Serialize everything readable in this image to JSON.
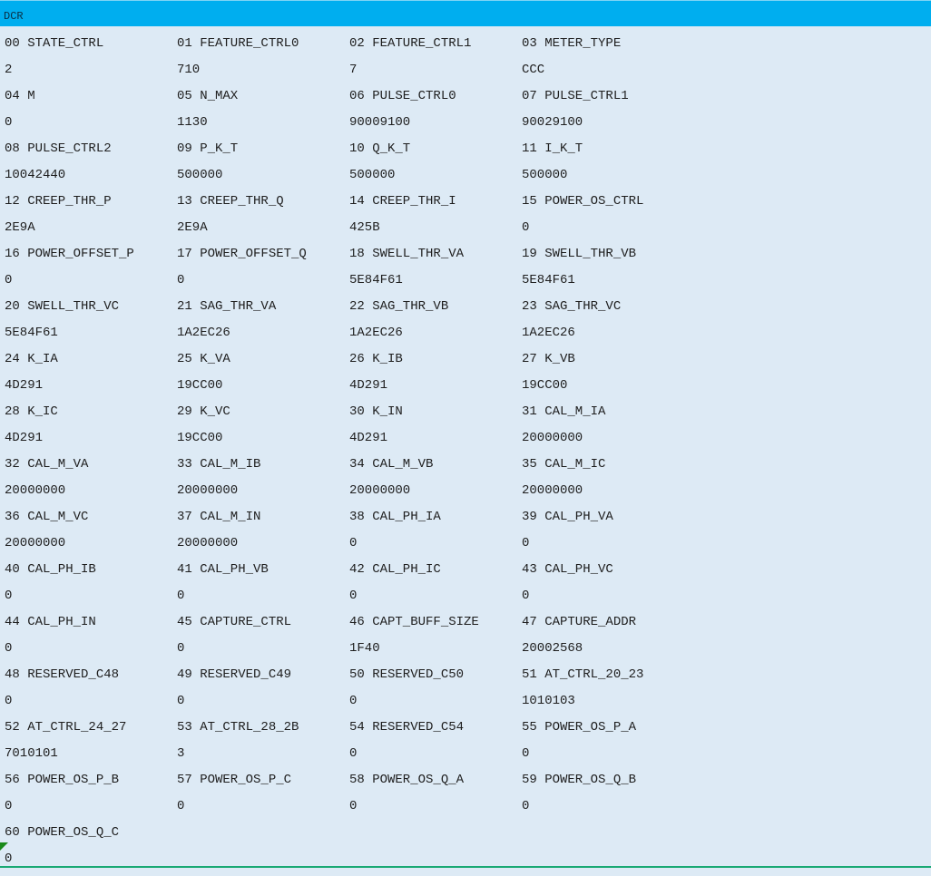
{
  "window": {
    "title": "DCR"
  },
  "registers": [
    {
      "name": "00 STATE_CTRL",
      "value": "2"
    },
    {
      "name": "01 FEATURE_CTRL0",
      "value": "710"
    },
    {
      "name": "02 FEATURE_CTRL1",
      "value": "7"
    },
    {
      "name": "03 METER_TYPE",
      "value": "CCC"
    },
    {
      "name": "04 M",
      "value": "0"
    },
    {
      "name": "05 N_MAX",
      "value": "1130"
    },
    {
      "name": "06 PULSE_CTRL0",
      "value": "90009100"
    },
    {
      "name": "07 PULSE_CTRL1",
      "value": "90029100"
    },
    {
      "name": "08 PULSE_CTRL2",
      "value": "10042440"
    },
    {
      "name": "09 P_K_T",
      "value": "500000"
    },
    {
      "name": "10 Q_K_T",
      "value": "500000"
    },
    {
      "name": "11 I_K_T",
      "value": "500000"
    },
    {
      "name": "12 CREEP_THR_P",
      "value": "2E9A"
    },
    {
      "name": "13 CREEP_THR_Q",
      "value": "2E9A"
    },
    {
      "name": "14 CREEP_THR_I",
      "value": "425B"
    },
    {
      "name": "15 POWER_OS_CTRL",
      "value": "0"
    },
    {
      "name": "16 POWER_OFFSET_P",
      "value": "0"
    },
    {
      "name": "17 POWER_OFFSET_Q",
      "value": "0"
    },
    {
      "name": "18 SWELL_THR_VA",
      "value": "5E84F61"
    },
    {
      "name": "19 SWELL_THR_VB",
      "value": "5E84F61"
    },
    {
      "name": "20 SWELL_THR_VC",
      "value": "5E84F61"
    },
    {
      "name": "21 SAG_THR_VA",
      "value": "1A2EC26"
    },
    {
      "name": "22 SAG_THR_VB",
      "value": "1A2EC26"
    },
    {
      "name": "23 SAG_THR_VC",
      "value": "1A2EC26"
    },
    {
      "name": "24 K_IA",
      "value": "4D291"
    },
    {
      "name": "25 K_VA",
      "value": "19CC00"
    },
    {
      "name": "26 K_IB",
      "value": "4D291"
    },
    {
      "name": "27 K_VB",
      "value": "19CC00"
    },
    {
      "name": "28 K_IC",
      "value": "4D291"
    },
    {
      "name": "29 K_VC",
      "value": "19CC00"
    },
    {
      "name": "30 K_IN",
      "value": "4D291"
    },
    {
      "name": "31 CAL_M_IA",
      "value": "20000000"
    },
    {
      "name": "32 CAL_M_VA",
      "value": "20000000"
    },
    {
      "name": "33 CAL_M_IB",
      "value": "20000000"
    },
    {
      "name": "34 CAL_M_VB",
      "value": "20000000"
    },
    {
      "name": "35 CAL_M_IC",
      "value": "20000000"
    },
    {
      "name": "36 CAL_M_VC",
      "value": "20000000"
    },
    {
      "name": "37 CAL_M_IN",
      "value": "20000000"
    },
    {
      "name": "38 CAL_PH_IA",
      "value": "0"
    },
    {
      "name": "39 CAL_PH_VA",
      "value": "0"
    },
    {
      "name": "40 CAL_PH_IB",
      "value": "0"
    },
    {
      "name": "41 CAL_PH_VB",
      "value": "0"
    },
    {
      "name": "42 CAL_PH_IC",
      "value": "0"
    },
    {
      "name": "43 CAL_PH_VC",
      "value": "0"
    },
    {
      "name": "44 CAL_PH_IN",
      "value": "0"
    },
    {
      "name": "45 CAPTURE_CTRL",
      "value": "0"
    },
    {
      "name": "46 CAPT_BUFF_SIZE",
      "value": "1F40"
    },
    {
      "name": "47 CAPTURE_ADDR",
      "value": "20002568"
    },
    {
      "name": "48 RESERVED_C48",
      "value": "0"
    },
    {
      "name": "49 RESERVED_C49",
      "value": "0"
    },
    {
      "name": "50 RESERVED_C50",
      "value": "0"
    },
    {
      "name": "51 AT_CTRL_20_23",
      "value": "1010103"
    },
    {
      "name": "52 AT_CTRL_24_27",
      "value": "7010101"
    },
    {
      "name": "53 AT_CTRL_28_2B",
      "value": "3"
    },
    {
      "name": "54 RESERVED_C54",
      "value": "0"
    },
    {
      "name": "55 POWER_OS_P_A",
      "value": "0"
    },
    {
      "name": "56 POWER_OS_P_B",
      "value": "0"
    },
    {
      "name": "57 POWER_OS_P_C",
      "value": "0"
    },
    {
      "name": "58 POWER_OS_Q_A",
      "value": "0"
    },
    {
      "name": "59 POWER_OS_Q_B",
      "value": "0"
    },
    {
      "name": "60 POWER_OS_Q_C",
      "value": "0"
    }
  ],
  "colors": {
    "title_bar": "#00aeef",
    "background": "#ddeaf5",
    "text": "#1e1e1e",
    "marker": "#1a8a1a"
  }
}
